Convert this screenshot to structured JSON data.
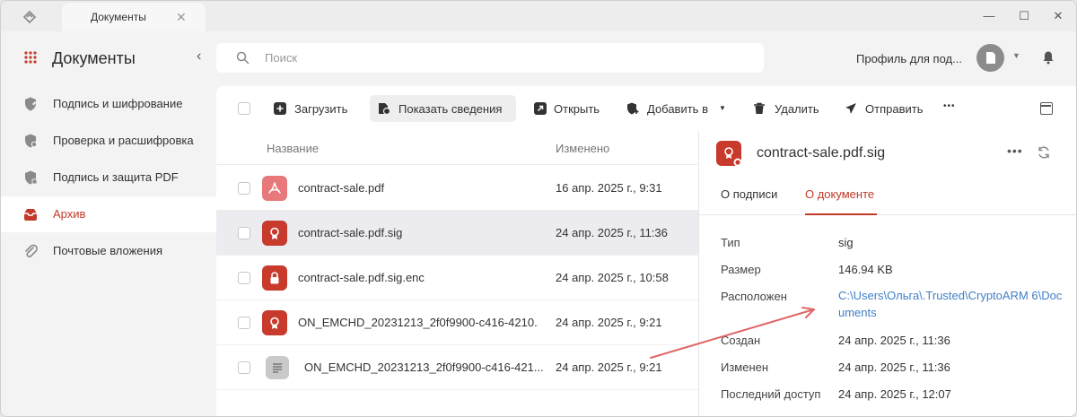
{
  "window": {
    "tab_label": "Документы",
    "tab_close": "✕",
    "minimize": "—",
    "maximize": "☐",
    "close": "✕"
  },
  "sidebar": {
    "title": "Документы",
    "collapse": "‹",
    "items": [
      {
        "label": "Подпись и шифрование",
        "icon": "shield-pen-icon",
        "active": false
      },
      {
        "label": "Проверка и расшифровка",
        "icon": "shield-check-icon",
        "active": false
      },
      {
        "label": "Подпись и защита PDF",
        "icon": "shield-pdf-icon",
        "active": false
      },
      {
        "label": "Архив",
        "icon": "archive-icon",
        "active": true
      },
      {
        "label": "Почтовые вложения",
        "icon": "paperclip-icon",
        "active": false
      }
    ]
  },
  "header": {
    "search_placeholder": "Поиск",
    "profile_name": "Профиль для под...",
    "avatar_caret": "▼"
  },
  "toolbar": {
    "upload": "Загрузить",
    "show_details": "Показать сведения",
    "open": "Открыть",
    "add_to": "Добавить в",
    "add_caret": "▼",
    "delete": "Удалить",
    "send": "Отправить",
    "more": "•••"
  },
  "files": {
    "col_name": "Название",
    "col_modified": "Изменено",
    "rows": [
      {
        "name": "contract-sale.pdf",
        "modified": "16 апр. 2025 г., 9:31",
        "type": "pdf",
        "selected": false
      },
      {
        "name": "contract-sale.pdf.sig",
        "modified": "24 апр. 2025 г., 11:36",
        "type": "sig",
        "selected": true
      },
      {
        "name": "contract-sale.pdf.sig.enc",
        "modified": "24 апр. 2025 г., 10:58",
        "type": "enc",
        "selected": false
      },
      {
        "name": "ON_EMCHD_20231213_2f0f9900-c416-4210...",
        "modified": "24 апр. 2025 г., 9:21",
        "type": "sig",
        "selected": false
      },
      {
        "name": "ON_EMCHD_20231213_2f0f9900-c416-421...",
        "modified": "24 апр. 2025 г., 9:21",
        "type": "doc",
        "selected": false
      }
    ]
  },
  "details": {
    "title": "contract-sale.pdf.sig",
    "more": "•••",
    "tabs": [
      "О подписи",
      "О документе"
    ],
    "active_tab": 1,
    "props": {
      "type_k": "Тип",
      "type_v": "sig",
      "size_k": "Размер",
      "size_v": "146.94 KB",
      "loc_k": "Расположен",
      "loc_v": "C:\\Users\\Ольга\\.Trusted\\CryptoARM 6\\Documents",
      "created_k": "Создан",
      "created_v": "24 апр. 2025 г., 11:36",
      "modified_k": "Изменен",
      "modified_v": "24 апр. 2025 г., 11:36",
      "access_k": "Последний доступ",
      "access_v": "24 апр. 2025 г., 12:07"
    }
  },
  "colors": {
    "accent": "#c23a2a",
    "link": "#3f7fc9",
    "pdf_icon": "#e8797a",
    "sig_icon": "#c73a2c",
    "doc_icon": "#c9c9c9",
    "annotation_arrow": "#e06666"
  }
}
